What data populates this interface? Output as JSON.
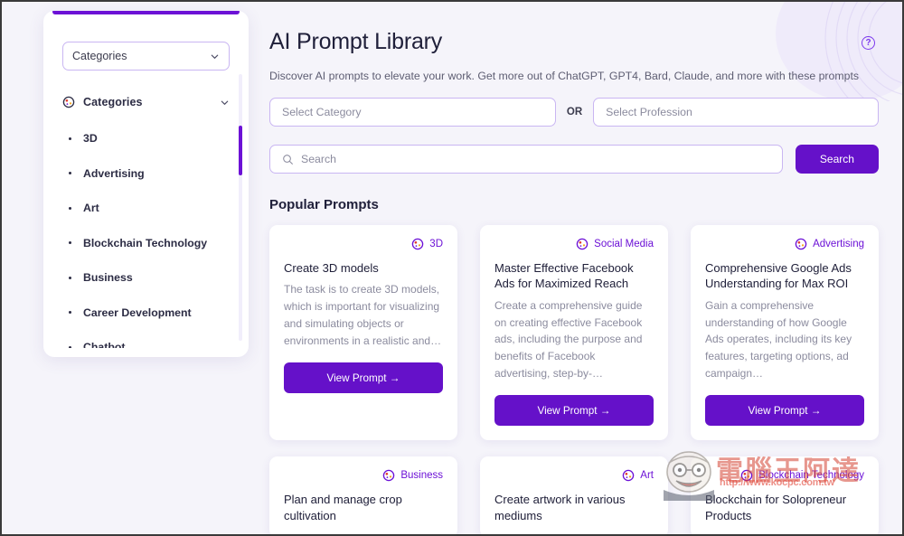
{
  "window": {
    "help_icon": "question-mark-icon"
  },
  "sidebar": {
    "select_label": "Categories",
    "group_label": "Categories",
    "items": [
      {
        "label": "3D"
      },
      {
        "label": "Advertising"
      },
      {
        "label": "Art"
      },
      {
        "label": "Blockchain Technology"
      },
      {
        "label": "Business"
      },
      {
        "label": "Career Development"
      },
      {
        "label": "Chatbot"
      }
    ]
  },
  "header": {
    "title": "AI Prompt Library",
    "subtitle": "Discover AI prompts to elevate your work. Get more out of ChatGPT, GPT4, Bard, Claude, and more with these prompts"
  },
  "filters": {
    "category_placeholder": "Select Category",
    "or_label": "OR",
    "profession_placeholder": "Select Profession"
  },
  "search": {
    "placeholder": "Search",
    "button_label": "Search",
    "icon": "search-icon"
  },
  "main": {
    "section_title": "Popular Prompts",
    "view_prompt_label": "View Prompt →",
    "cards": [
      {
        "category": "3D",
        "title": "Create 3D models",
        "description": "The task is to create 3D models, which is important for visualizing and simulating objects or environments in a realistic and…"
      },
      {
        "category": "Social Media",
        "title": "Master Effective Facebook Ads for Maximized Reach",
        "description": "Create a comprehensive guide on creating effective Facebook ads, including the purpose and benefits of Facebook advertising, step-by-…"
      },
      {
        "category": "Advertising",
        "title": "Comprehensive Google Ads Understanding for Max ROI",
        "description": "Gain a comprehensive understanding of how Google Ads operates, including its key features, targeting options, ad campaign…"
      },
      {
        "category": "Business",
        "title": "Plan and manage crop cultivation",
        "description": ""
      },
      {
        "category": "Art",
        "title": "Create artwork in various mediums",
        "description": ""
      },
      {
        "category": "Blockchain Technology",
        "title": "Blockchain for Solopreneur Products",
        "description": ""
      }
    ]
  },
  "watermark": {
    "text": "電腦王阿達",
    "url": "http://www.kocpc.com.tw"
  },
  "colors": {
    "accent": "#6511c9",
    "accent_alt": "#6c11d6",
    "border": "#c9b6f2",
    "page_bg": "#f5f4fa",
    "text": "#20203a",
    "muted": "#8b8b9e"
  }
}
